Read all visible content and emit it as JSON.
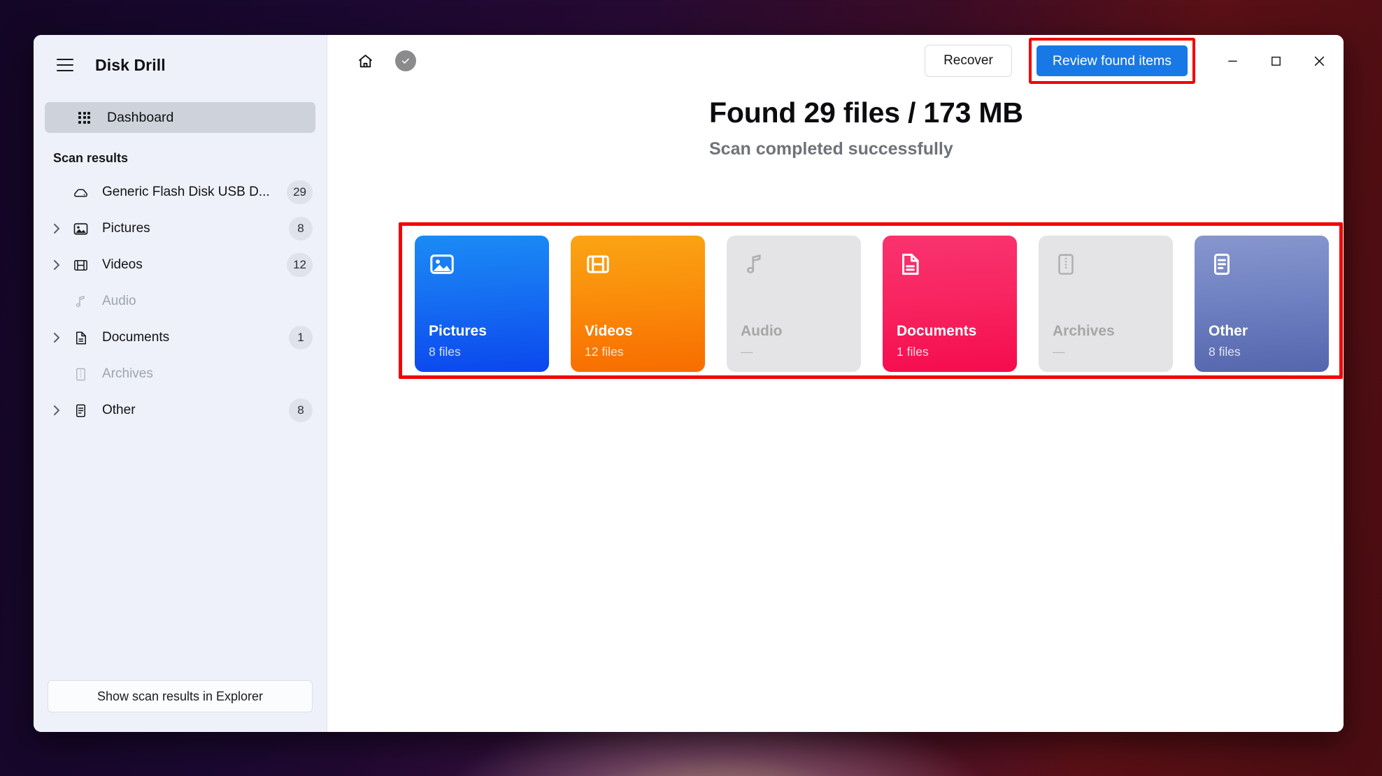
{
  "app": {
    "title": "Disk Drill"
  },
  "sidebar": {
    "menu_icon": "hamburger-icon",
    "dashboard": {
      "label": "Dashboard",
      "icon": "grid-dots-icon",
      "selected": true
    },
    "section_header": "Scan results",
    "tree": [
      {
        "label": "Generic Flash Disk USB D...",
        "badge": "29",
        "icon": "disk-drive-icon",
        "expandable": false,
        "disabled": false
      },
      {
        "label": "Pictures",
        "badge": "8",
        "icon": "image-icon",
        "expandable": true,
        "disabled": false
      },
      {
        "label": "Videos",
        "badge": "12",
        "icon": "film-icon",
        "expandable": true,
        "disabled": false
      },
      {
        "label": "Audio",
        "badge": "",
        "icon": "music-note-icon",
        "expandable": false,
        "disabled": true
      },
      {
        "label": "Documents",
        "badge": "1",
        "icon": "document-icon",
        "expandable": true,
        "disabled": false
      },
      {
        "label": "Archives",
        "badge": "",
        "icon": "archive-zip-icon",
        "expandable": false,
        "disabled": true
      },
      {
        "label": "Other",
        "badge": "8",
        "icon": "file-lines-icon",
        "expandable": true,
        "disabled": false
      }
    ],
    "explorer_button": "Show scan results in Explorer"
  },
  "toolbar": {
    "home_icon": "home-icon",
    "status_icon": "check-circle-icon",
    "recover_label": "Recover",
    "review_label": "Review found items",
    "review_accent": "#1878e6",
    "highlight_color": "#f40000",
    "minimize_icon": "minimize-icon",
    "maximize_icon": "maximize-icon",
    "close_icon": "close-icon"
  },
  "main": {
    "headline": "Found 29 files / 173 MB",
    "subline": "Scan completed successfully",
    "cards": [
      {
        "name": "Pictures",
        "count": "8 files",
        "icon": "image-icon",
        "color": "#1773f2",
        "disabled": false
      },
      {
        "name": "Videos",
        "count": "12 files",
        "icon": "film-icon",
        "color": "#fa8f0b",
        "disabled": false
      },
      {
        "name": "Audio",
        "count": "—",
        "icon": "music-note-icon",
        "color": "#e4e4e6",
        "disabled": true
      },
      {
        "name": "Documents",
        "count": "1 files",
        "icon": "document-icon",
        "color": "#f82561",
        "disabled": false
      },
      {
        "name": "Archives",
        "count": "—",
        "icon": "archive-zip-icon",
        "color": "#e4e4e6",
        "disabled": true
      },
      {
        "name": "Other",
        "count": "8 files",
        "icon": "file-lines-icon",
        "color": "#7082c2",
        "disabled": false
      }
    ]
  }
}
